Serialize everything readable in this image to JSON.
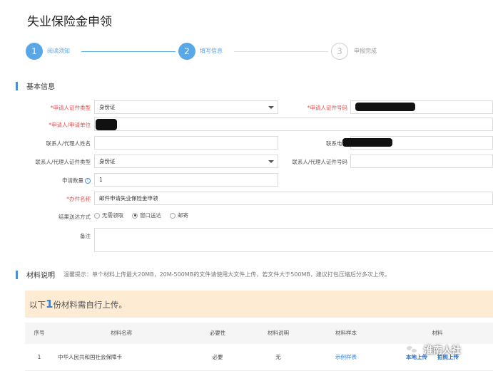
{
  "page": {
    "title": "失业保险金申领"
  },
  "steps": [
    {
      "num": "1",
      "label": "阅读须知",
      "state": "active"
    },
    {
      "num": "2",
      "label": "填写信息",
      "state": "active"
    },
    {
      "num": "3",
      "label": "申报完成",
      "state": "inactive"
    }
  ],
  "basic_info": {
    "title": "基本信息",
    "applicant_id_type": {
      "label": "*申请人证件类型",
      "value": "身份证"
    },
    "applicant_id_number": {
      "label": "*申请人证件号码"
    },
    "applicant_unit": {
      "label": "*申请人/申请单位"
    },
    "contact_name": {
      "label": "联系人/代理人姓名"
    },
    "contact_phone": {
      "label": "联系电话"
    },
    "contact_id_type": {
      "label": "联系人/代理人证件类型",
      "value": "身份证"
    },
    "contact_id_number": {
      "label": "联系人/代理人证件号码"
    },
    "quantity": {
      "label": "申请数量",
      "value": "1"
    },
    "case_name": {
      "label": "*办件名称",
      "value": "邮件申请失业保险金申领"
    },
    "delivery": {
      "label": "结果送达方式",
      "options": [
        {
          "label": "无需领取",
          "checked": false
        },
        {
          "label": "窗口送达",
          "checked": true
        },
        {
          "label": "邮寄",
          "checked": false
        }
      ]
    },
    "remarks": {
      "label": "备注"
    }
  },
  "materials": {
    "title": "材料说明",
    "hint": "温馨提示：单个材料上传最大20MB，20M-500MB的文件请使用大文件上传，若文件大于500MB，建议打包压缩后分多次上传。",
    "notice_prefix": "以下",
    "notice_count": "1",
    "notice_suffix": "份材料需自行上传。",
    "columns": [
      "序号",
      "材料名称",
      "必要性",
      "材料说明",
      "材料样本",
      "材料"
    ],
    "rows": [
      {
        "index": "1",
        "name": "中华人民共和国社会保障卡",
        "necessity": "必要",
        "description": "无",
        "sample": "示例样表",
        "local_upload": "本地上传",
        "photo_upload": "拍照上传"
      }
    ]
  },
  "watermark": {
    "text": "淮南人社"
  },
  "colors": {
    "accent": "#5aa7e8",
    "link": "#3d7fd1",
    "required": "#e05050",
    "notice_bg": "#fdebd3"
  }
}
